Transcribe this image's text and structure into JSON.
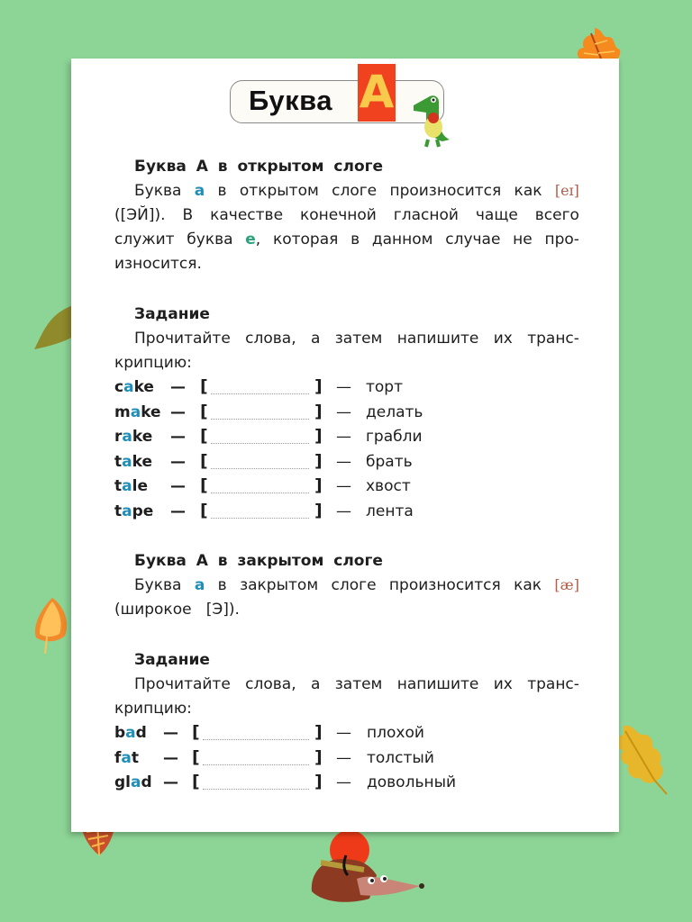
{
  "header": {
    "title": "Буква",
    "letter": "A"
  },
  "section1": {
    "title": "Буква  А  в  открытом  слоге",
    "para_lines": [
      [
        "Буква",
        "а",
        "в",
        "открытом",
        "слоге",
        "произносится",
        "как",
        "[eɪ]"
      ],
      [
        "([ЭЙ]).",
        "В",
        "качестве",
        "конечной",
        "гласной",
        "чаще",
        "всего"
      ],
      [
        "служит",
        "буква",
        "е,",
        "которая",
        "в",
        "данном",
        "случае",
        "не",
        "про-"
      ],
      [
        "износится."
      ]
    ],
    "highlight_a": "а",
    "highlight_e": "е",
    "phonetic": "[eɪ]"
  },
  "task1": {
    "title": "Задание",
    "instruction_line1": [
      "Прочитайте",
      "слова,",
      "а",
      "затем",
      "напишите",
      "их",
      "транс-"
    ],
    "instruction_line2": "крипцию:",
    "words": [
      {
        "pre": "c",
        "vowel": "a",
        "post": "ke",
        "translation": "торт"
      },
      {
        "pre": "m",
        "vowel": "a",
        "post": "ke",
        "translation": "делать"
      },
      {
        "pre": "r",
        "vowel": "a",
        "post": "ke",
        "translation": "грабли"
      },
      {
        "pre": "t",
        "vowel": "a",
        "post": "ke",
        "translation": "брать"
      },
      {
        "pre": "t",
        "vowel": "a",
        "post": "le",
        "translation": "хвост"
      },
      {
        "pre": "t",
        "vowel": "a",
        "post": "pe",
        "translation": "лента"
      }
    ]
  },
  "section2": {
    "title": "Буква  А  в  закрытом  слоге",
    "para_line1": [
      "Буква",
      "а",
      "в",
      "закрытом",
      "слоге",
      "произносится",
      "как",
      "[æ]"
    ],
    "para_line2": "(широкое   [Э]).",
    "phonetic": "[æ]"
  },
  "task2": {
    "title": "Задание",
    "instruction_line1": [
      "Прочитайте",
      "слова,",
      "а",
      "затем",
      "напишите",
      "их",
      "транс-"
    ],
    "instruction_line2": "крипцию:",
    "words": [
      {
        "pre": "b",
        "vowel": "a",
        "post": "d",
        "translation": "плохой"
      },
      {
        "pre": "f",
        "vowel": "a",
        "post": "t",
        "translation": "толстый"
      },
      {
        "pre": "gl",
        "vowel": "a",
        "post": "d",
        "translation": "довольный"
      }
    ]
  },
  "symbols": {
    "dash_short": "—",
    "dash_long": "—",
    "bracket_open": "[",
    "bracket_close": "]"
  },
  "colors": {
    "background": "#8dd596",
    "vowel_highlight": "#1f8fb8",
    "e_highlight": "#2ba37a",
    "phonetic": "#b45e4a",
    "title_tile": "#f0421e"
  }
}
